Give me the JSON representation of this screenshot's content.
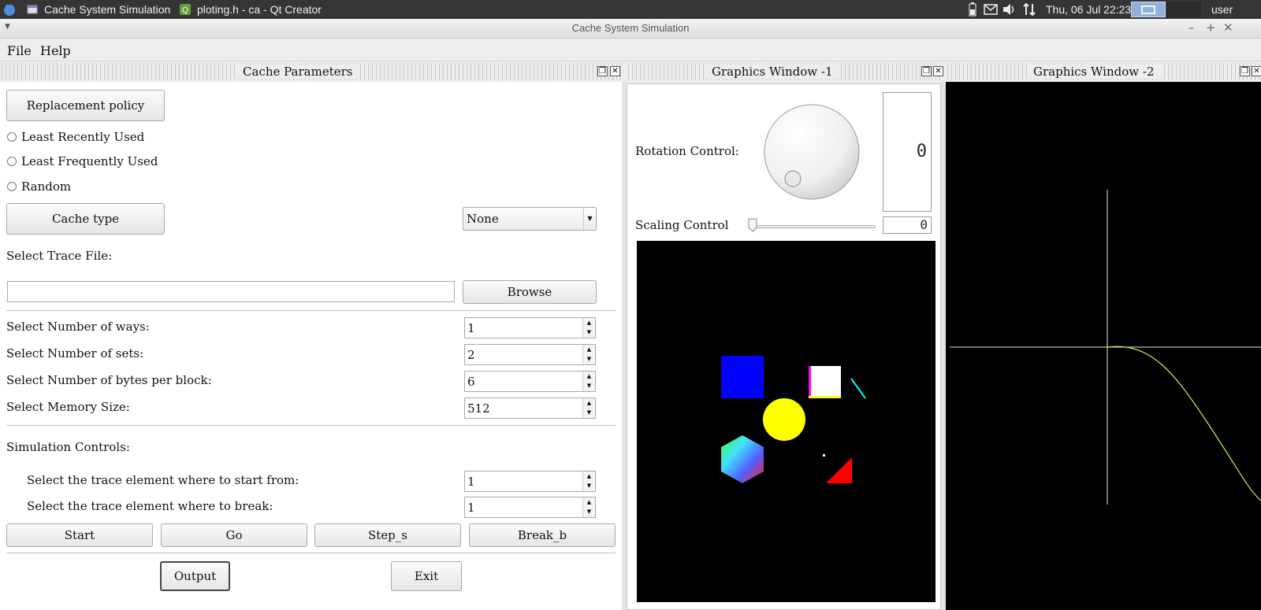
{
  "taskbar": {
    "tasks": [
      {
        "label": "Cache System Simulation",
        "icon": "window-icon"
      },
      {
        "label": "ploting.h - ca - Qt Creator",
        "icon": "qt-creator-icon"
      }
    ],
    "clock": "Thu, 06 Jul  22:23",
    "user": "user"
  },
  "window": {
    "title": "Cache System Simulation"
  },
  "menu": {
    "items": [
      "File",
      "Help"
    ]
  },
  "cache_params": {
    "dock_title": "Cache Parameters",
    "replacement_policy_button": "Replacement policy",
    "policies": [
      "Least Recently Used",
      "Least Frequently Used",
      "Random"
    ],
    "cache_type_button": "Cache type",
    "cache_type_value": "None",
    "select_trace_label": "Select Trace File:",
    "trace_file_value": "",
    "browse_button": "Browse",
    "ways_label": "Select Number of ways:",
    "ways_value": "1",
    "sets_label": "Select Number of sets:",
    "sets_value": "2",
    "bytes_label": "Select Number of bytes per block:",
    "bytes_value": "6",
    "memory_label": "Select Memory Size:",
    "memory_value": "512",
    "sim_controls_label": "Simulation Controls:",
    "start_from_label": "Select the trace element where to start from:",
    "start_from_value": "1",
    "break_label": "Select the trace element where to break:",
    "break_value": "1",
    "buttons": {
      "start": "Start",
      "go": "Go",
      "step": "Step_s",
      "break": "Break_b",
      "output": "Output",
      "exit": "Exit"
    }
  },
  "graphics1": {
    "dock_title": "Graphics Window -1",
    "rotation_label": "Rotation Control:",
    "rotation_lcd": "0",
    "scaling_label": "Scaling Control",
    "scaling_lcd": "0"
  },
  "graphics2": {
    "dock_title": "Graphics Window -2"
  },
  "colors": {
    "shape_blue": "#0000ff",
    "shape_yellow": "#ffff00",
    "shape_red": "#ff0000",
    "curve": "#e6e64d",
    "axis": "#e8e8c8"
  }
}
